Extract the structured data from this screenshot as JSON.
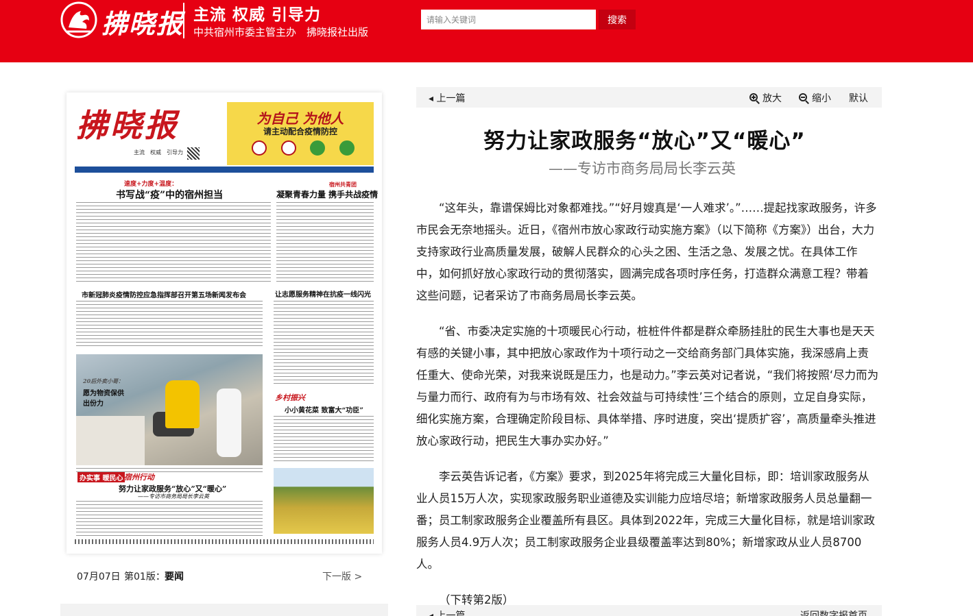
{
  "header": {
    "logo_text": "拂晓报",
    "slogan": "主流 权威 引导力",
    "sub_slogan": "中共宿州市委主管主办　拂晓报社出版",
    "search_placeholder": "请输入关键词",
    "search_button": "搜索"
  },
  "colors": {
    "brand_red": "#e60012",
    "button_red": "#c40010"
  },
  "newspaper": {
    "masthead": "拂晓报",
    "masthead_sub": "主流　权威　引导力",
    "ad_title": "为自己 为他人",
    "ad_subtitle": "请主动配合疫情防控",
    "headlines": [
      "速度+力度+温度：",
      "书写战“疫”中的宿州担当",
      "宿州共青团",
      "凝聚青春力量 携手共战疫情",
      "市新冠肺炎疫情防控应急指挥部召开第五场新闻发布会",
      "让志愿服务精神在抗疫一线闪光",
      "20后外卖小哥：",
      "愿为物资保供出份力",
      "乡村振兴",
      "小小黄花菜 致富大“功臣”",
      "办实事 暖民心",
      "宿州行动",
      "努力让家政服务“放心”又“暖心”",
      "——专访市商务局局长李云英"
    ]
  },
  "page_nav": {
    "date": "07月07日",
    "page": "第01版：",
    "section": "要闻",
    "next": "下一版 >"
  },
  "toolbar": {
    "prev": "◂ 上一篇",
    "zoom_in": "放大",
    "zoom_out": "缩小",
    "default": "默认"
  },
  "article": {
    "title": "努力让家政服务“放心”又“暖心”",
    "subtitle": "——专访市商务局局长李云英",
    "paragraphs": [
      "“这年头，靠谱保姆比对象都难找。”“好月嫂真是‘一人难求’。”……提起找家政服务，许多市民会无奈地摇头。近日，《宿州市放心家政行动实施方案》（以下简称《方案》）出台，大力支持家政行业高质量发展，破解人民群众的心头之困、生活之急、发展之忧。在具体工作中，如何抓好放心家政行动的贯彻落实，圆满完成各项时序任务，打造群众满意工程？带着这些问题，记者采访了市商务局局长李云英。",
      "“省、市委决定实施的十项暖民心行动，桩桩件件都是群众牵肠挂肚的民生大事也是天天有感的关键小事，其中把放心家政作为十项行动之一交给商务部门具体实施，我深感肩上责任重大、使命光荣，对我来说既是压力，也是动力。”李云英对记者说，“我们将按照‘尽力而为与量力而行、政府有为与市场有效、社会效益与可持续性’三个结合的原则，立足自身实际，细化实施方案，合理确定阶段目标、具体举措、序时进度，突出‘提质扩容’，高质量牵头推进放心家政行动，把民生大事办实办好。”",
      "李云英告诉记者，《方案》要求，到2025年将完成三大量化目标，即：培训家政服务从业人员15万人次，实现家政服务职业道德及实训能力应培尽培；新增家政服务人员总量翻一番；员工制家政服务企业覆盖所有县区。具体到2022年，完成三大量化目标，就是培训家政服务人员4.9万人次；员工制家政服务企业县级覆盖率达到80%；新增家政从业人员8700人。",
      "（下转第2版）"
    ]
  },
  "bottom_nav": {
    "prev": "◂ 上一篇",
    "home": "返回数字报首页"
  }
}
